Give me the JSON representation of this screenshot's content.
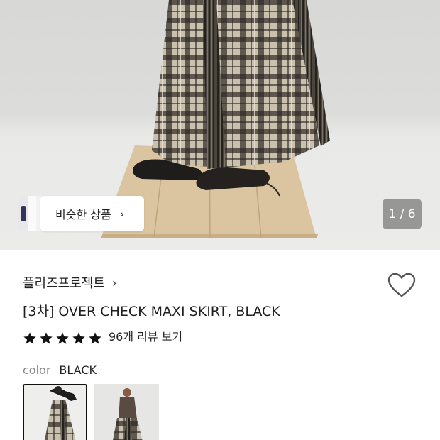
{
  "gallery": {
    "similar_label": "비슷한 상품",
    "similar_chevron": "›",
    "counter": "1 / 6"
  },
  "product": {
    "brand": "플리즈프로젝트",
    "brand_chevron": "›",
    "title": "[3차] OVER CHECK MAXI SKIRT, BLACK",
    "rating_stars": 5,
    "review_link": "96개 리뷰 보기",
    "color_label": "color",
    "color_value": "BLACK"
  },
  "options": [
    {
      "name": "swatch-1",
      "selected": true
    },
    {
      "name": "swatch-2",
      "selected": false
    }
  ],
  "colors": {
    "accent": "#111111",
    "counter_bg": "#646464",
    "muted_text": "#888888"
  },
  "icons": {
    "heart": "heart-outline-icon",
    "star": "star-filled-icon",
    "chevron": "chevron-right-icon"
  }
}
